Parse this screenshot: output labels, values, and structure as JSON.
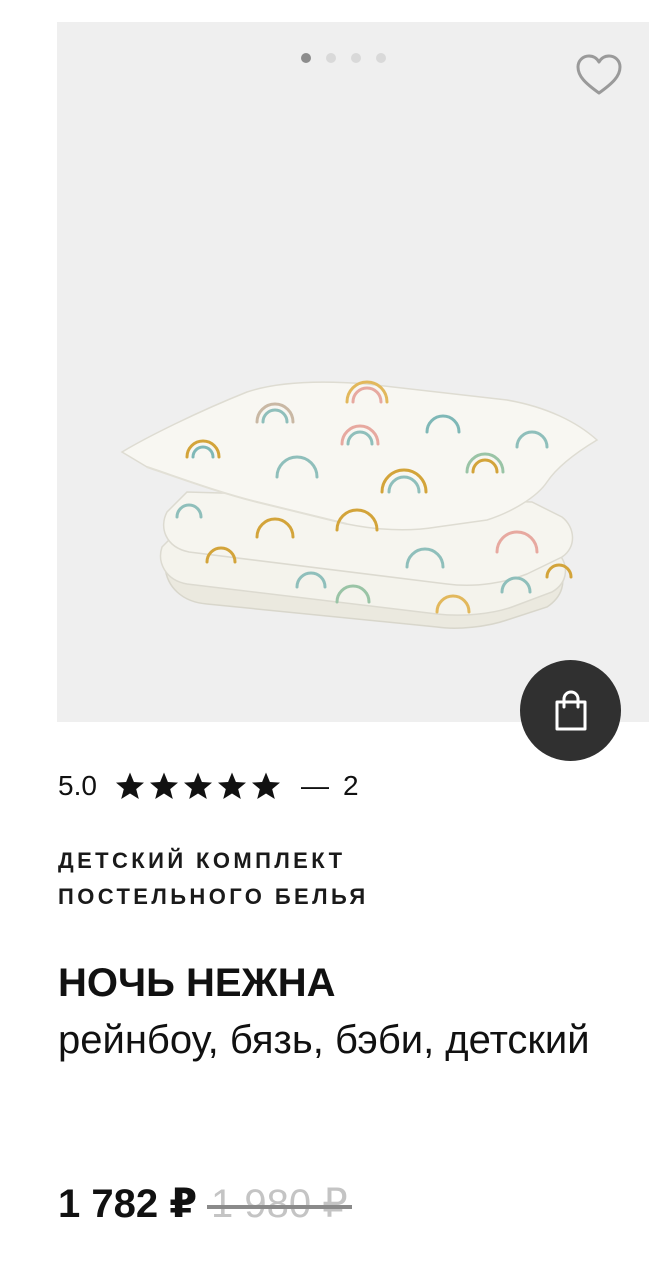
{
  "gallery": {
    "slide_count": 4,
    "active_slide": 1,
    "favorite_icon": "heart-outline-icon",
    "product_image": "folded-bedding-rainbow-print"
  },
  "cart": {
    "icon": "shopping-bag-icon"
  },
  "rating": {
    "value": "5.0",
    "stars": 5,
    "dash": "—",
    "count": "2"
  },
  "product": {
    "category_line1": "ДЕТСКИЙ КОМПЛЕКТ",
    "category_line2": "ПОСТЕЛЬНОГО БЕЛЬЯ",
    "brand": "НОЧЬ НЕЖНА",
    "description": "рейнбоу, бязь, бэби, детский"
  },
  "price": {
    "current": "1 782 ₽",
    "old": "1 980 ₽"
  },
  "colors": {
    "gallery_bg": "#efefef",
    "cart_button": "#303030",
    "dot_active": "#8c8c8c",
    "dot_inactive": "#d9d9d9"
  }
}
